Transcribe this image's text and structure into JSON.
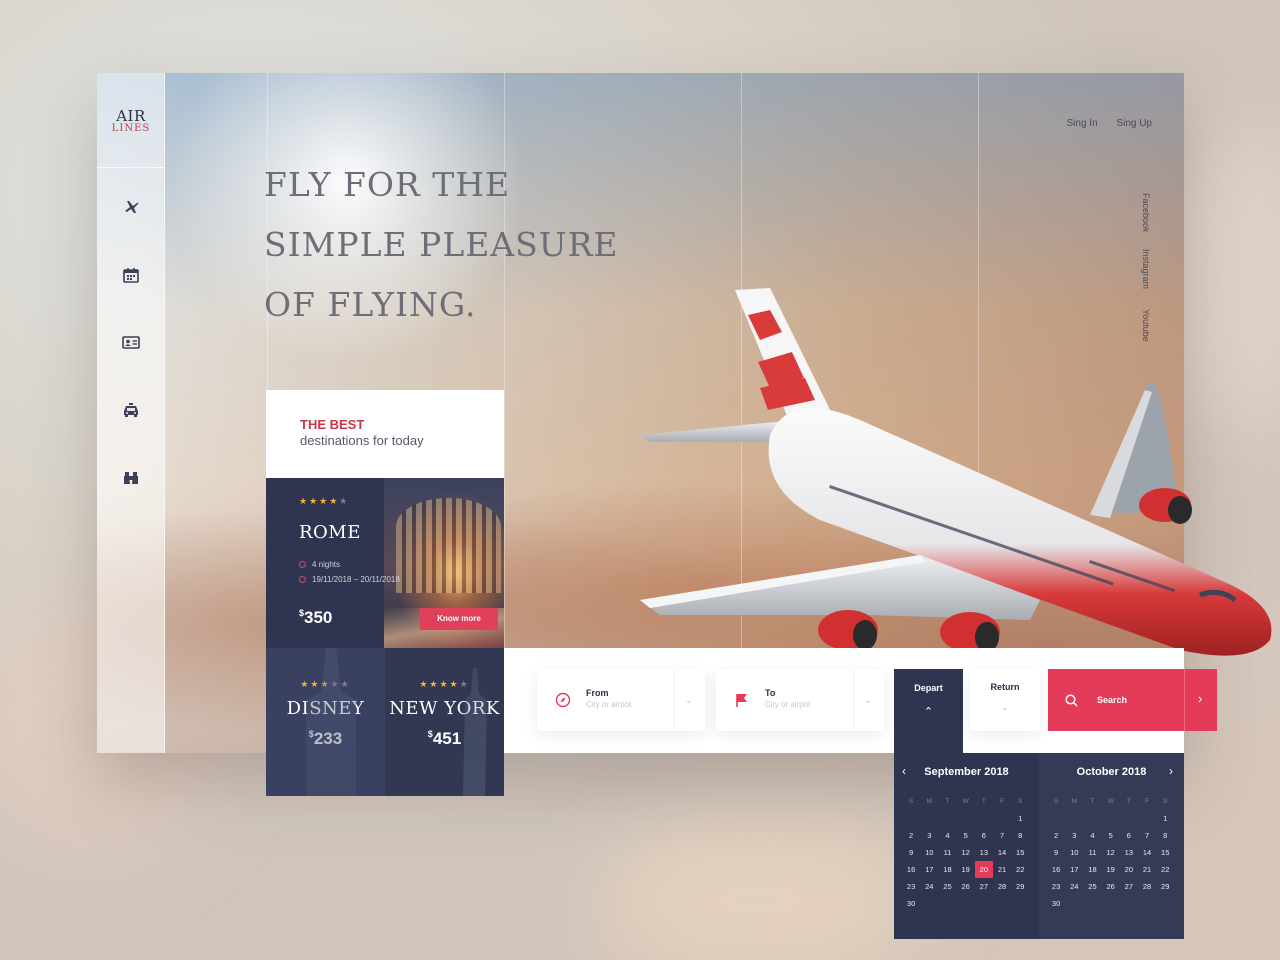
{
  "brand": {
    "line1": "AIR",
    "line2": "LINES"
  },
  "sidebar": {
    "icons": [
      "plane-icon",
      "calendar-icon",
      "id-card-icon",
      "taxi-icon",
      "binoculars-icon"
    ]
  },
  "topnav": {
    "sign_in": "Sing In",
    "sign_up": "Sing Up"
  },
  "social": [
    "Facebook",
    "Instagram",
    "Youtube"
  ],
  "hero": {
    "line1": "FLY FOR THE",
    "line2": "SIMPLE PLEASURE",
    "line3": "OF FLYING."
  },
  "destinations": {
    "heading_accent": "THE BEST",
    "heading_rest": "destinations for today",
    "featured": {
      "city": "ROME",
      "stars": 4,
      "nights": "4 nights",
      "dates": "19/11/2018 – 20/11/2018",
      "price": "350",
      "currency": "$",
      "cta": "Know more"
    },
    "tiles": [
      {
        "city": "DISNEY",
        "stars": 3,
        "price": "233",
        "currency": "$"
      },
      {
        "city": "NEW YORK",
        "stars": 4,
        "price": "451",
        "currency": "$"
      }
    ]
  },
  "search": {
    "from_label": "From",
    "from_placeholder": "City or airpot",
    "to_label": "To",
    "to_placeholder": "City or airpot",
    "depart_label": "Depart",
    "return_label": "Return",
    "search_label": "Search"
  },
  "calendar": {
    "weekdays": [
      "S",
      "M",
      "T",
      "W",
      "T",
      "F",
      "S"
    ],
    "months": [
      {
        "title": "September 2018",
        "rows": [
          [
            "",
            "",
            "",
            "",
            "",
            "",
            "1"
          ],
          [
            "2",
            "3",
            "4",
            "5",
            "6",
            "7",
            "8"
          ],
          [
            "9",
            "10",
            "11",
            "12",
            "13",
            "14",
            "15"
          ],
          [
            "16",
            "17",
            "18",
            "19",
            "20",
            "21",
            "22"
          ],
          [
            "23",
            "24",
            "25",
            "26",
            "27",
            "28",
            "29"
          ],
          [
            "30",
            "",
            "",
            "",
            "",
            "",
            ""
          ]
        ],
        "selected": "20"
      },
      {
        "title": "October 2018",
        "rows": [
          [
            "",
            "",
            "",
            "",
            "",
            "",
            "1"
          ],
          [
            "2",
            "3",
            "4",
            "5",
            "6",
            "7",
            "8"
          ],
          [
            "9",
            "10",
            "11",
            "12",
            "13",
            "14",
            "15"
          ],
          [
            "16",
            "17",
            "18",
            "19",
            "20",
            "21",
            "22"
          ],
          [
            "23",
            "24",
            "25",
            "26",
            "27",
            "28",
            "29"
          ],
          [
            "30",
            "",
            "",
            "",
            "",
            "",
            ""
          ]
        ],
        "selected": ""
      }
    ]
  },
  "colors": {
    "accent": "#e43b58",
    "navy": "#2f3550",
    "star": "#f2b630"
  }
}
